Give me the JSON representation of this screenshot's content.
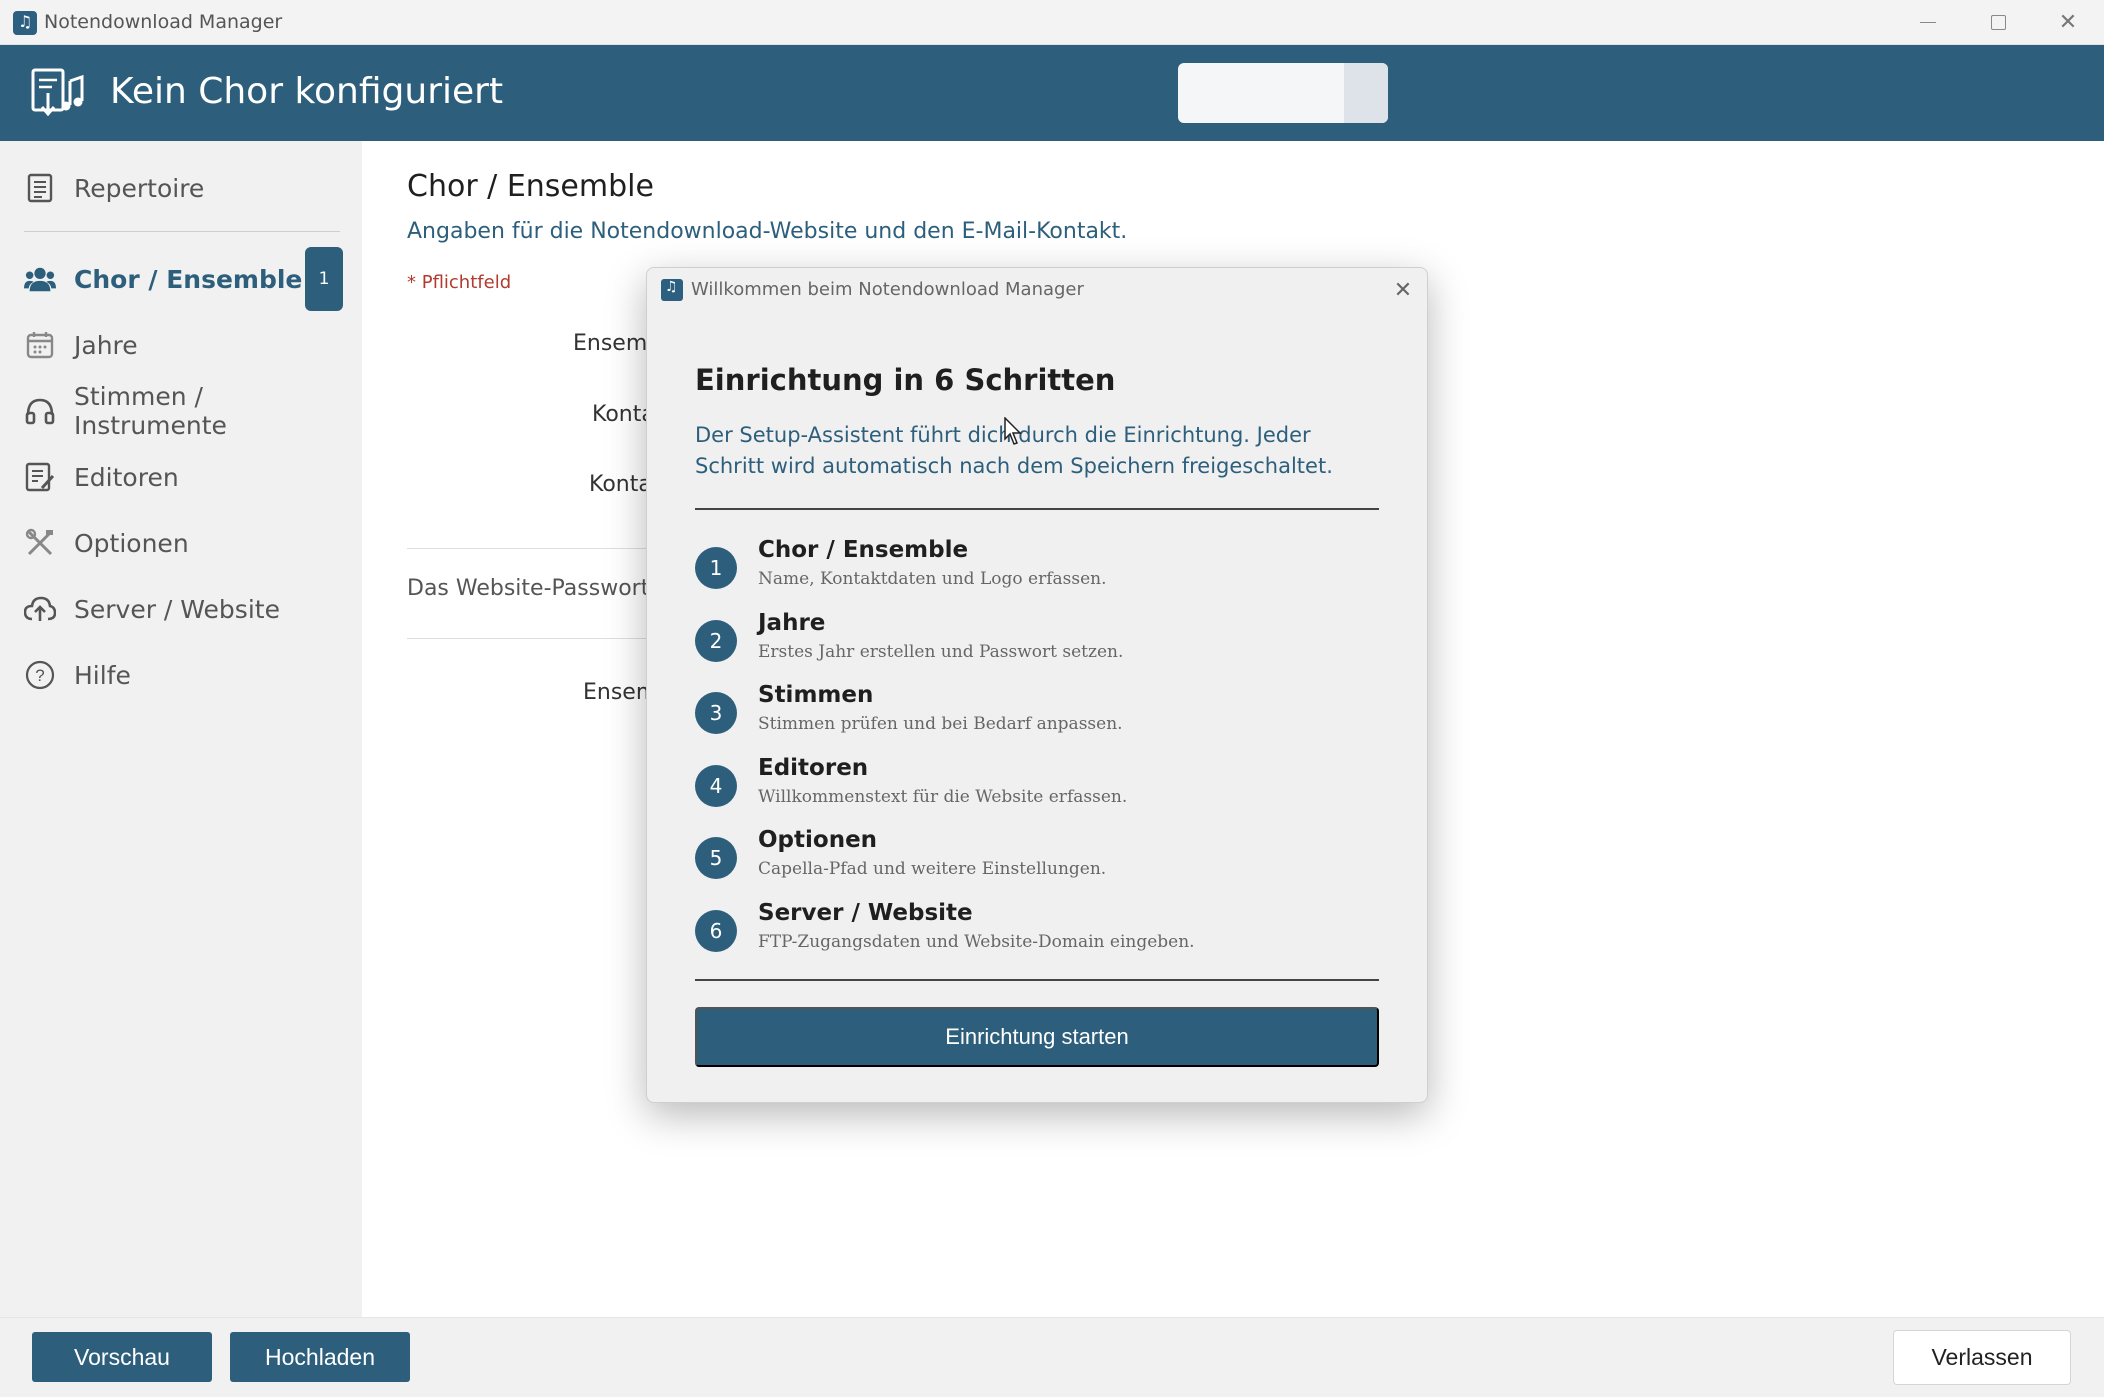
{
  "window": {
    "title": "Notendownload Manager"
  },
  "header": {
    "title": "Kein Chor konfiguriert"
  },
  "sidebar": {
    "items": [
      {
        "label": "Repertoire",
        "icon": "document-list-icon"
      },
      {
        "label": "Chor / Ensemble",
        "icon": "users-icon",
        "badge": "1",
        "active": true
      },
      {
        "label": "Jahre",
        "icon": "calendar-icon"
      },
      {
        "label": "Stimmen / Instrumente",
        "icon": "headphones-icon"
      },
      {
        "label": "Editoren",
        "icon": "edit-document-icon"
      },
      {
        "label": "Optionen",
        "icon": "tools-icon"
      },
      {
        "label": "Server / Website",
        "icon": "cloud-upload-icon"
      },
      {
        "label": "Hilfe",
        "icon": "help-circle-icon"
      }
    ]
  },
  "main": {
    "title": "Chor / Ensemble",
    "subtitle": "Angaben für die Notendownload-Website und den E-Mail-Kontakt.",
    "required_note": "* Pflichtfeld",
    "labels": [
      "Ensemb",
      "Konta",
      "Konta",
      "Ensem"
    ],
    "password_note": "Das Website-Passwort w"
  },
  "footer": {
    "preview_label": "Vorschau",
    "upload_label": "Hochladen",
    "exit_label": "Verlassen"
  },
  "dialog": {
    "title": "Willkommen beim Notendownload Manager",
    "heading": "Einrichtung in 6 Schritten",
    "description": "Der Setup-Assistent führt dich durch die Einrichtung. Jeder Schritt wird automatisch nach dem Speichern freigeschaltet.",
    "steps": [
      {
        "number": "1",
        "title": "Chor / Ensemble",
        "desc": "Name, Kontaktdaten und Logo erfassen."
      },
      {
        "number": "2",
        "title": "Jahre",
        "desc": "Erstes Jahr erstellen und Passwort setzen."
      },
      {
        "number": "3",
        "title": "Stimmen",
        "desc": "Stimmen prüfen und bei Bedarf anpassen."
      },
      {
        "number": "4",
        "title": "Editoren",
        "desc": "Willkommenstext für die Website erfassen."
      },
      {
        "number": "5",
        "title": "Optionen",
        "desc": "Capella-Pfad und weitere Einstellungen."
      },
      {
        "number": "6",
        "title": "Server / Website",
        "desc": "FTP-Zugangsdaten und Website-Domain eingeben."
      }
    ],
    "start_label": "Einrichtung starten"
  },
  "colors": {
    "accent": "#2d5f7c",
    "required": "#b23a2e",
    "sidebar_bg": "#f1f1f1"
  }
}
